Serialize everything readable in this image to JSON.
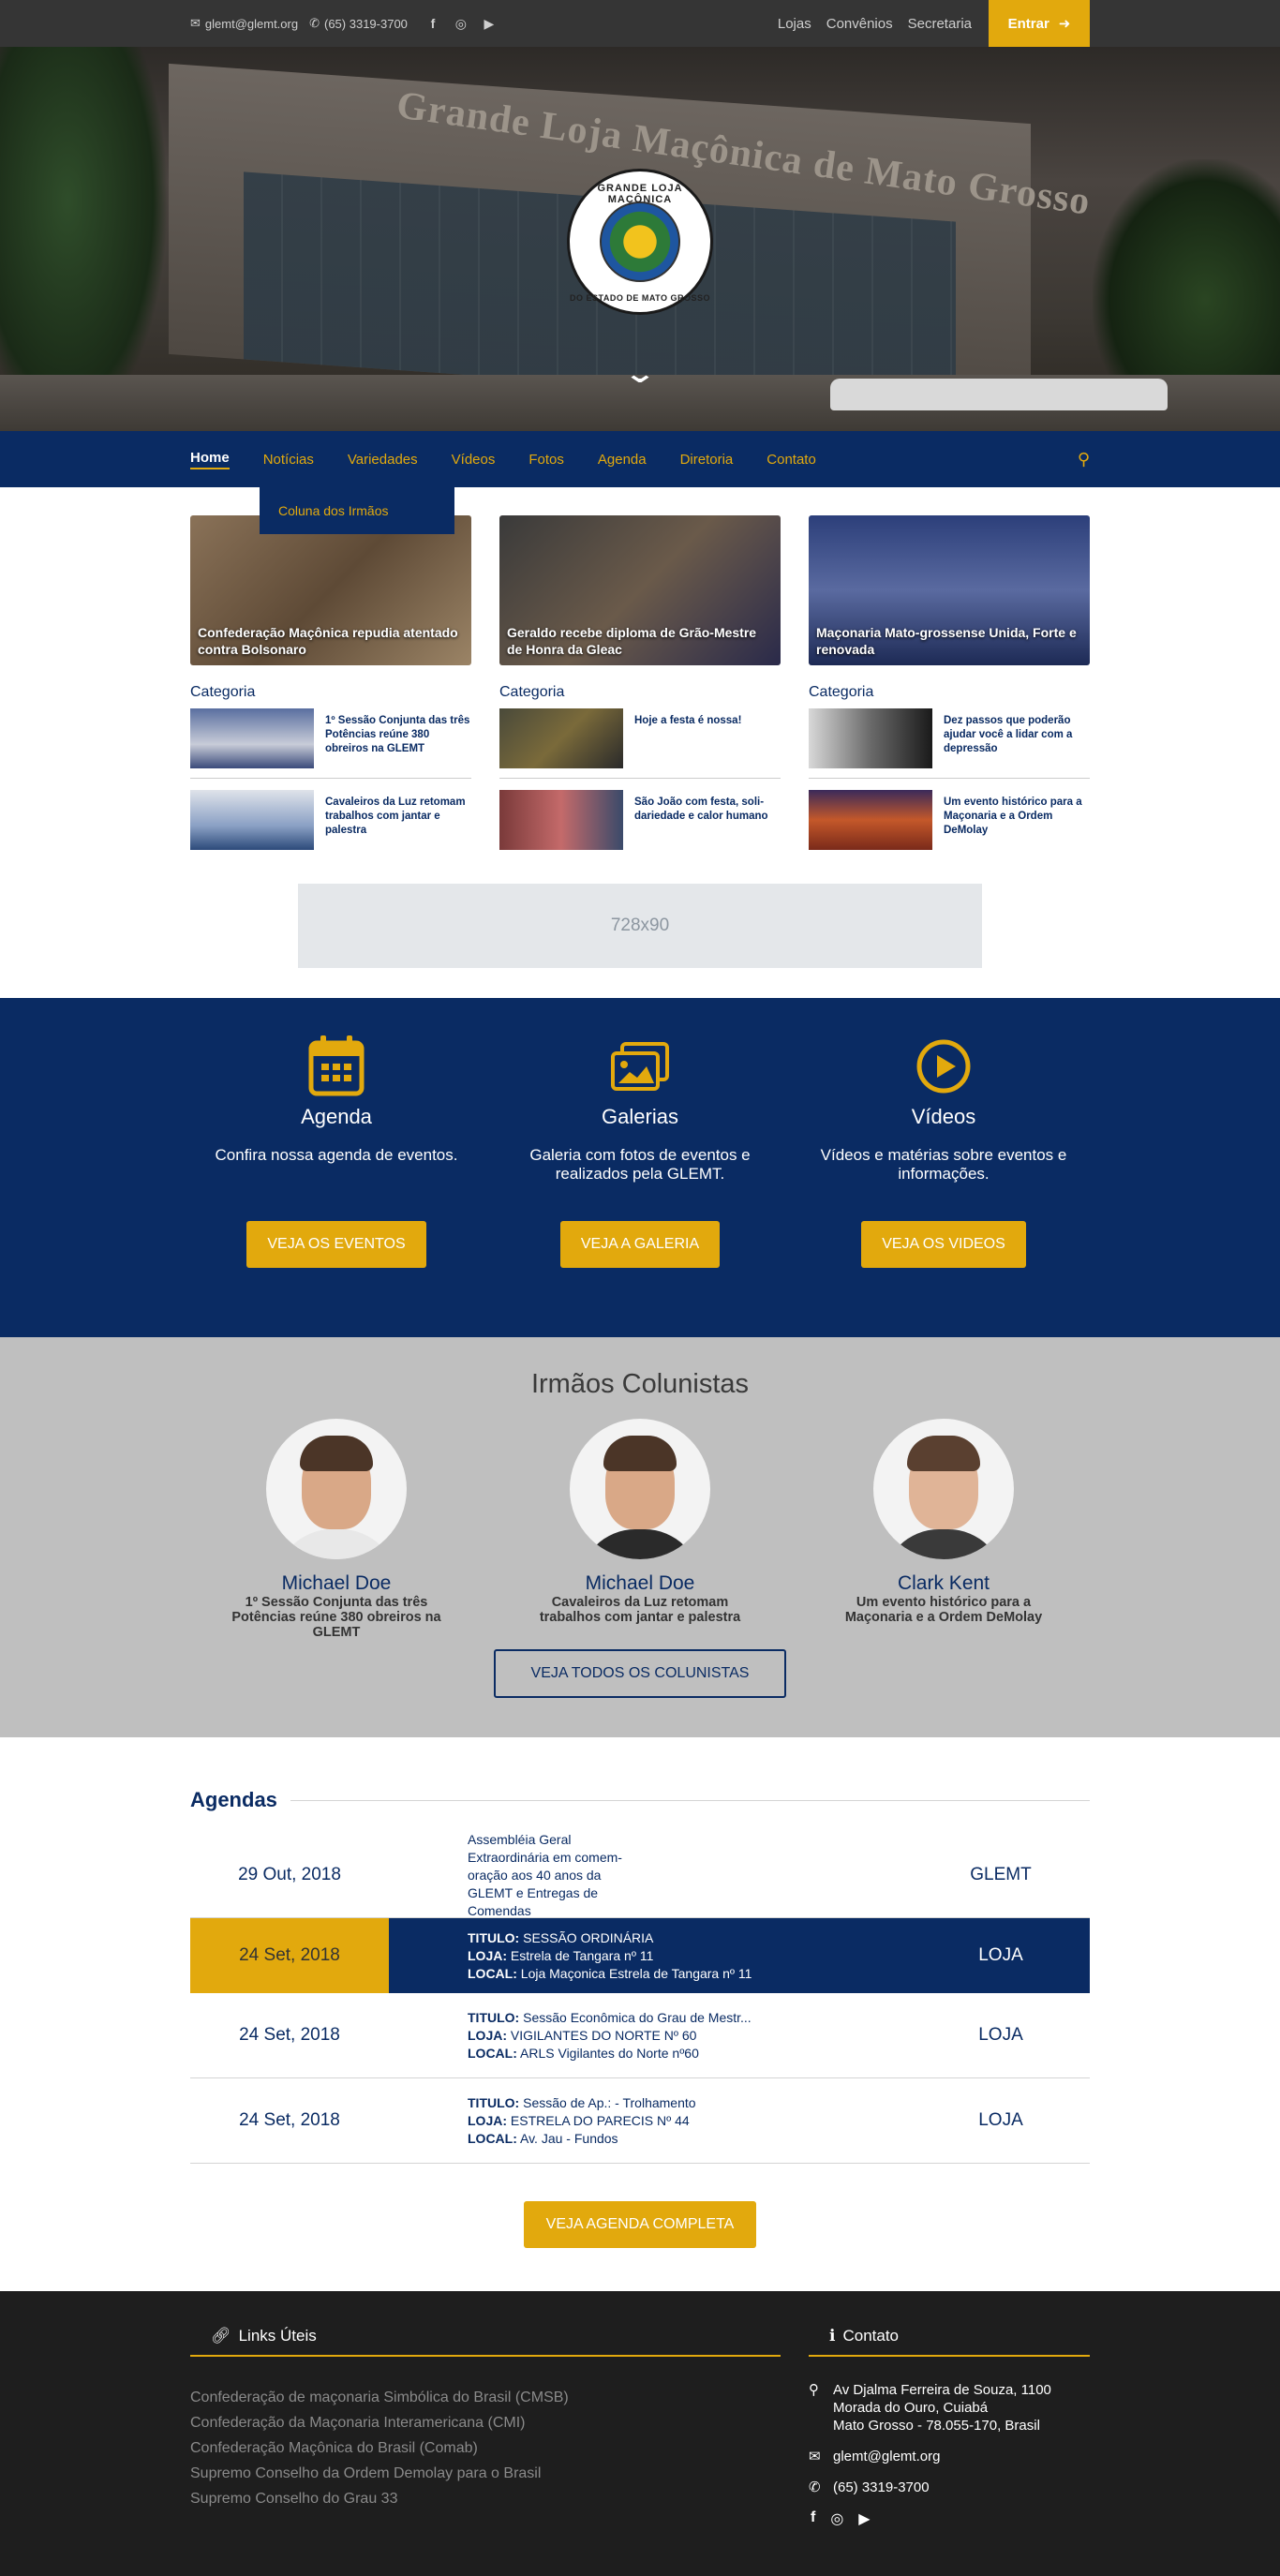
{
  "topbar": {
    "email": "glemt@glemt.org",
    "phone": "(65) 3319-3700",
    "links": [
      "Lojas",
      "Convênios",
      "Secretaria"
    ],
    "login_label": "Entrar"
  },
  "hero": {
    "building_text": "Grande Loja Maçônica de Mato Grosso",
    "seal_top": "GRANDE LOJA MAÇÔNICA",
    "seal_bottom": "DO ESTADO DE MATO GROSSO"
  },
  "nav": {
    "items": [
      "Home",
      "Notícias",
      "Variedades",
      "Vídeos",
      "Fotos",
      "Agenda",
      "Diretoria",
      "Contato"
    ],
    "dropdown_item": "Coluna dos Irmãos"
  },
  "featured": [
    {
      "title": "Confederação Maçônica repudia atentado contra Bolsonaro"
    },
    {
      "title": "Geraldo recebe diploma de Grão-Mestre de Honra da Gleac"
    },
    {
      "title": "Maçonaria Mato-grossense Unida, Forte e renovada"
    }
  ],
  "columns": [
    {
      "category": "Categoria",
      "items": [
        "1º Sessão Conjunta das três Potências reúne 380 obreiros na GLEMT",
        "Cavaleiros da Luz retomam trabalhos com jantar e palestra"
      ]
    },
    {
      "category": "Categoria",
      "items": [
        "Hoje a festa é nossa!",
        "São João com festa, soli-dariedade e calor humano"
      ]
    },
    {
      "category": "Categoria",
      "items": [
        "Dez passos que poderão ajudar você a lidar com a depressão",
        "Um evento histórico para a Maçonaria e a Ordem DeMolay"
      ]
    }
  ],
  "ad": {
    "label": "728x90"
  },
  "features": [
    {
      "title": "Agenda",
      "text": "Confira nossa agenda de eventos.",
      "button": "VEJA OS EVENTOS",
      "icon": "calendar-icon"
    },
    {
      "title": "Galerias",
      "text": "Galeria com fotos de eventos e realizados pela GLEMT.",
      "button": "VEJA A GALERIA",
      "icon": "images-icon"
    },
    {
      "title": "Vídeos",
      "text": "Vídeos e matérias sobre eventos e informações.",
      "button": "VEJA OS VIDEOS",
      "icon": "play-icon"
    }
  ],
  "columnists": {
    "heading": "Irmãos Colunistas",
    "people": [
      {
        "name": "Michael Doe",
        "text": "1º Sessão Conjunta das três Potências reúne 380 obreiros na GLEMT"
      },
      {
        "name": "Michael Doe",
        "text": "Cavaleiros da Luz retomam trabalhos com jantar e palestra"
      },
      {
        "name": "Clark Kent",
        "text": "Um evento histórico para a Maçonaria e a Ordem DeMolay"
      }
    ],
    "button": "VEJA TODOS OS COLUNISTAS"
  },
  "agenda": {
    "heading": "Agendas",
    "rows": [
      {
        "date": "29 Out, 2018",
        "plain": "Assembléia Geral Extraordinária em comem-oração aos 40 anos da GLEMT e Entregas de Comendas",
        "org": "GLEMT"
      },
      {
        "date": "24 Set, 2018",
        "titulo": "SESSÃO ORDINÁRIA",
        "loja": "Estrela de Tangara nº 11",
        "local": "Loja Maçonica Estrela de Tangara nº 11",
        "org": "LOJA"
      },
      {
        "date": "24 Set, 2018",
        "titulo": "Sessão Econômica do Grau de Mestr...",
        "loja": "VIGILANTES DO NORTE Nº 60",
        "local": "ARLS Vigilantes do Norte nº60",
        "org": "LOJA"
      },
      {
        "date": "24 Set, 2018",
        "titulo": "Sessão de Ap.: - Trolhamento",
        "loja": "ESTRELA DO PARECIS Nº 44",
        "local": "Av. Jau - Fundos",
        "org": "LOJA"
      }
    ],
    "labels": {
      "titulo": "TITULO:",
      "loja": "LOJA:",
      "local": "LOCAL:"
    },
    "button": "VEJA AGENDA COMPLETA"
  },
  "footer": {
    "links_heading": "Links Úteis",
    "links": [
      "Confederação de maçonaria Simbólica do Brasil (CMSB)",
      "Confederação da Maçonaria Interamericana (CMI)",
      "Confederação Maçônica do Brasil (Comab)",
      "Supremo Conselho da Ordem Demolay para o Brasil",
      "Supremo Conselho do Grau 33"
    ],
    "contact_heading": "Contato",
    "address": [
      "Av Djalma Ferreira de Souza, 1100",
      "Morada do Ouro, Cuiabá",
      "Mato Grosso - 78.055-170, Brasil"
    ],
    "email": "glemt@glemt.org",
    "phone": "(65) 3319-3700"
  },
  "colors": {
    "navy": "#0a2b63",
    "gold": "#e2a90d",
    "dark": "#353535",
    "footer": "#1e1e1e",
    "grey": "#bfbfbf"
  }
}
